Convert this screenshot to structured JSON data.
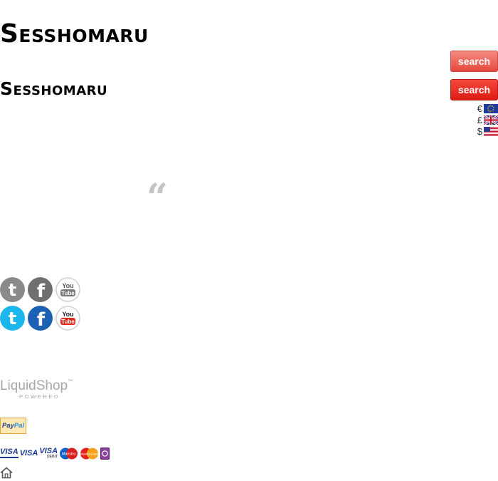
{
  "header": {
    "logo_text": "Sesshomaru",
    "search_button_label": "search",
    "search_button_hover_label": "search"
  },
  "currencies": [
    {
      "symbol": "€",
      "flag": "eu-flag-icon"
    },
    {
      "symbol": "£",
      "flag": "uk-flag-icon"
    },
    {
      "symbol": "$",
      "flag": "us-flag-icon"
    }
  ],
  "quote_mark": "“",
  "social": {
    "twitter_icon_label": "t",
    "facebook_icon_label": "f",
    "youtube_icon_line1": "You",
    "youtube_icon_line2": "Tube",
    "colors": {
      "twitter": "#1bb6ec",
      "facebook": "#1d61b4",
      "youtube": "#e02b20",
      "inactive": "#8a8a8a"
    }
  },
  "footer": {
    "liquidshop_brand": "LiquidShop",
    "liquidshop_tm": "™",
    "liquidshop_powered": "POWERED",
    "paypal_pay": "Pay",
    "paypal_pal": "Pal",
    "cards": {
      "visa1": "VISA",
      "visa2": "VISA",
      "visa3": "VISA",
      "visa3_sub": "DEBIT",
      "maestro": "Maestro",
      "mastercard": "MasterCard"
    }
  }
}
